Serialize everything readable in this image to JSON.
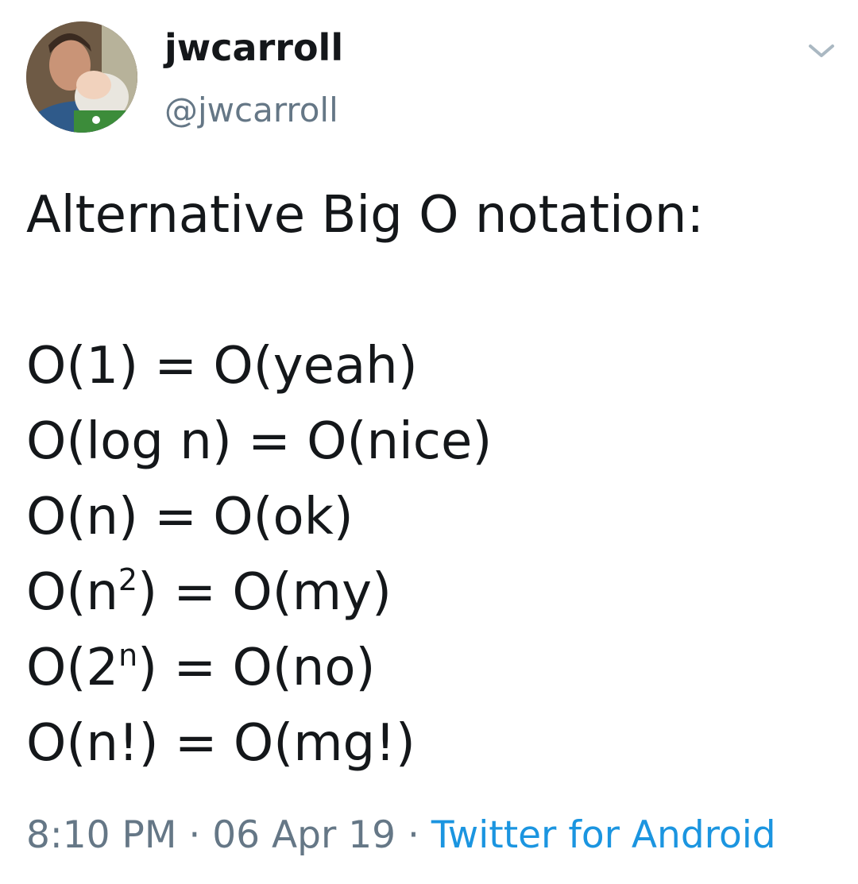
{
  "author": {
    "display_name": "jwcarroll",
    "handle": "@jwcarroll",
    "avatar_icon": "profile-photo"
  },
  "tweet": {
    "intro": "Alternative Big O notation:",
    "lines": [
      {
        "lhs_base": "O(1)",
        "lhs_sup": "",
        "lhs_tail": "",
        "rhs": "= O(yeah)"
      },
      {
        "lhs_base": "O(log n)",
        "lhs_sup": "",
        "lhs_tail": "",
        "rhs": "= O(nice)"
      },
      {
        "lhs_base": "O(n)",
        "lhs_sup": "",
        "lhs_tail": "",
        "rhs": "= O(ok)"
      },
      {
        "lhs_base": "O(n",
        "lhs_sup": "2",
        "lhs_tail": ")",
        "rhs": "= O(my)"
      },
      {
        "lhs_base": "O(2",
        "lhs_sup": "n",
        "lhs_tail": ")",
        "rhs": "= O(no)"
      },
      {
        "lhs_base": "O(n!)",
        "lhs_sup": "",
        "lhs_tail": "",
        "rhs": "= O(mg!)"
      }
    ]
  },
  "meta": {
    "time": "8:10 PM",
    "separator": " · ",
    "date": "06 Apr 19",
    "source": "Twitter for Android"
  },
  "colors": {
    "text": "#14171a",
    "secondary": "#657786",
    "link": "#1b95e0"
  },
  "icons": {
    "menu": "chevron-down-icon"
  }
}
